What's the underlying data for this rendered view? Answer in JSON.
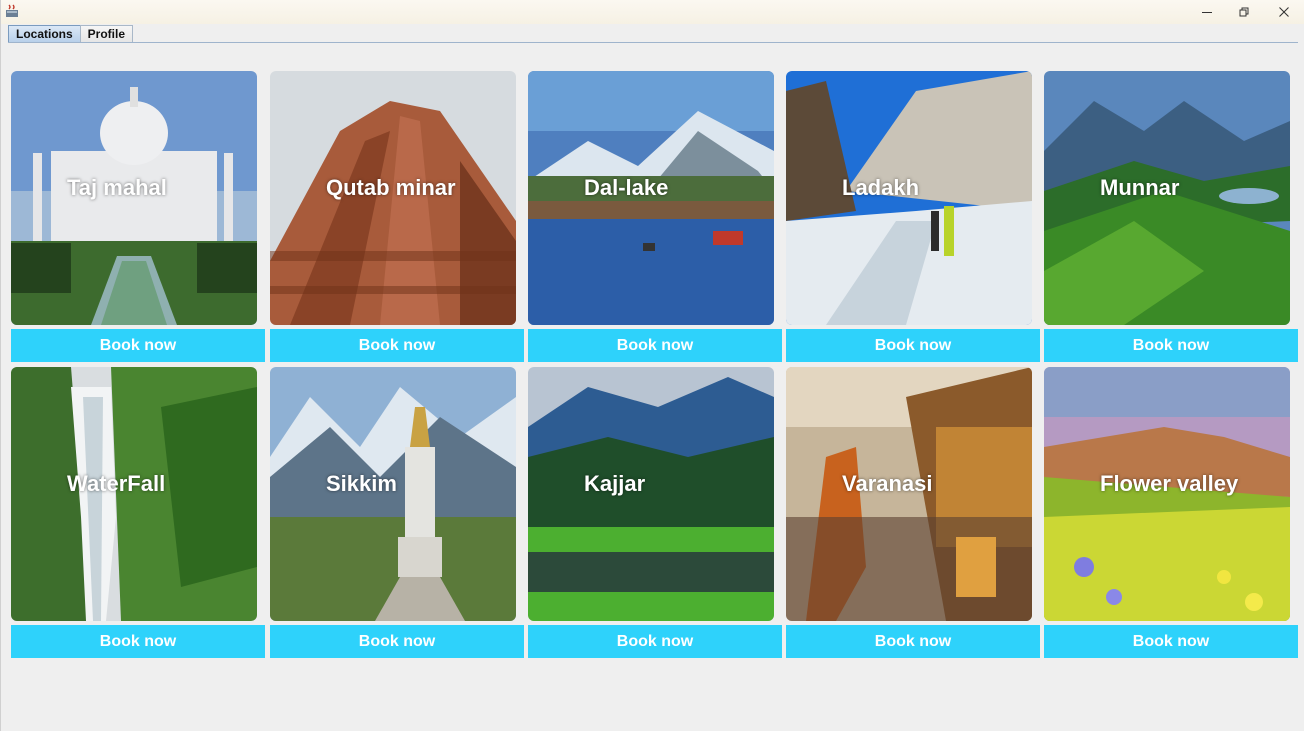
{
  "tabs": [
    {
      "label": "Locations",
      "active": true
    },
    {
      "label": "Profile",
      "active": false
    }
  ],
  "window_controls": [
    "minimize-icon",
    "restore-icon",
    "close-icon"
  ],
  "accent_color": "#2ed2fb",
  "locations": [
    {
      "name": "Taj mahal",
      "button": "Book now"
    },
    {
      "name": "Qutab minar",
      "button": "Book now"
    },
    {
      "name": "Dal-lake",
      "button": "Book now"
    },
    {
      "name": "Ladakh",
      "button": "Book now"
    },
    {
      "name": "Munnar",
      "button": "Book now"
    },
    {
      "name": "WaterFall",
      "button": "Book now"
    },
    {
      "name": "Sikkim",
      "button": "Book now"
    },
    {
      "name": "Kajjar",
      "button": "Book now"
    },
    {
      "name": "Varanasi",
      "button": "Book now"
    },
    {
      "name": "Flower valley",
      "button": "Book now"
    }
  ]
}
